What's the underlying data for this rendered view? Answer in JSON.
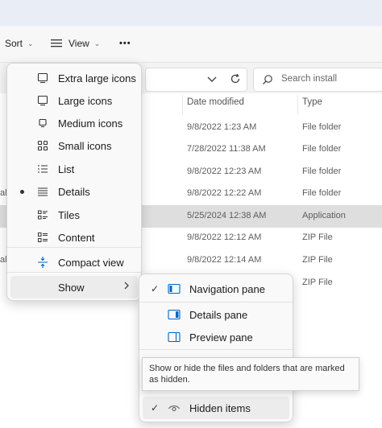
{
  "toolbar": {
    "sort_label": "Sort",
    "view_label": "View",
    "more_label": "•••"
  },
  "search": {
    "placeholder": "Search install"
  },
  "columns": {
    "date_modified": "Date modified",
    "type": "Type"
  },
  "rows": [
    {
      "date": "9/8/2022 1:23 AM",
      "type": "File folder",
      "left": ""
    },
    {
      "date": "7/28/2022 11:38 AM",
      "type": "File folder",
      "left": ""
    },
    {
      "date": "9/8/2022 12:23 AM",
      "type": "File folder",
      "left": ""
    },
    {
      "date": "9/8/2022 12:22 AM",
      "type": "File folder",
      "left": "al"
    },
    {
      "date": "5/25/2024 12:38 AM",
      "type": "Application",
      "left": ""
    },
    {
      "date": "9/8/2022 12:12 AM",
      "type": "ZIP File",
      "left": ""
    },
    {
      "date": "9/8/2022 12:14 AM",
      "type": "ZIP File",
      "left": "al"
    },
    {
      "date": "",
      "type": "ZIP File",
      "left": ""
    }
  ],
  "view_menu": {
    "items": [
      {
        "label": "Extra large icons",
        "icon": "monitor-icon"
      },
      {
        "label": "Large icons",
        "icon": "monitor-icon"
      },
      {
        "label": "Medium icons",
        "icon": "monitor-small-icon"
      },
      {
        "label": "Small icons",
        "icon": "grid-icon"
      },
      {
        "label": "List",
        "icon": "list-icon"
      },
      {
        "label": "Details",
        "icon": "details-icon",
        "selected": true
      },
      {
        "label": "Tiles",
        "icon": "tiles-icon"
      },
      {
        "label": "Content",
        "icon": "content-icon"
      },
      {
        "label": "Compact view",
        "icon": "compact-view-icon"
      },
      {
        "label": "Show",
        "icon": "chevron-right-icon"
      }
    ]
  },
  "show_menu": {
    "items": [
      {
        "label": "Navigation pane",
        "checked": true,
        "icon": "navigation-pane-icon"
      },
      {
        "label": "Details pane",
        "checked": false,
        "icon": "details-pane-icon"
      },
      {
        "label": "Preview pane",
        "checked": false,
        "icon": "preview-pane-icon"
      },
      {
        "label": "Hidden items",
        "checked": true,
        "icon": "eye-icon"
      }
    ]
  },
  "tooltip": {
    "text": "Show or hide the files and folders that are marked as hidden."
  },
  "colors": {
    "accent": "#0067c0",
    "selected_row": "#dedede"
  }
}
